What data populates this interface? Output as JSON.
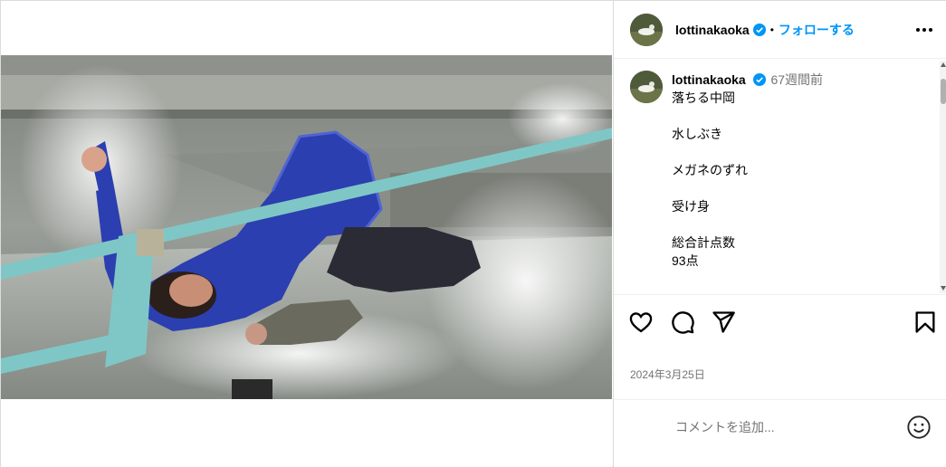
{
  "post": {
    "username": "lottinakaoka",
    "follow_label": "フォローする",
    "separator": "•",
    "more_icon": "more-horizontal-icon",
    "verified_icon": "verified-badge-icon"
  },
  "caption": {
    "username": "lottinakaoka",
    "time_ago": "67週間前",
    "lines": [
      "落ちる中岡",
      "",
      "水しぶき",
      "",
      "メガネのずれ",
      "",
      "受け身",
      "",
      "総合計点数",
      "93点"
    ]
  },
  "actions": {
    "like_icon": "heart-icon",
    "comment_icon": "comment-icon",
    "share_icon": "share-paper-plane-icon",
    "save_icon": "bookmark-icon"
  },
  "date": "2024年3月25日",
  "comment_box": {
    "placeholder": "コメントを追加...",
    "emoji_icon": "emoji-smiley-icon"
  },
  "colors": {
    "accent": "#0095f6",
    "muted": "#737373",
    "border": "#dbdbdb",
    "jersey": "#2b3fb0",
    "strap": "#7fc7c6"
  }
}
